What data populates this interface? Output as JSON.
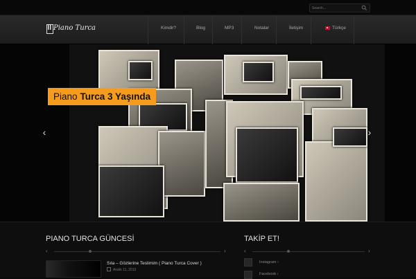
{
  "search": {
    "placeholder": "Search..."
  },
  "logo": {
    "text": "Piano Turca"
  },
  "nav": {
    "items": [
      "Kimdir?",
      "Blog",
      "MP3",
      "Notalar",
      "İletişim",
      "Türkçe"
    ]
  },
  "slider": {
    "caption_light": "Piano",
    "caption_bold": "Turca 3 Yaşında"
  },
  "blog": {
    "title": "PIANO TURCA GÜNCESİ",
    "post_title": "Sıla – Gözlerine Teslimim ( Piano Turca Cover )",
    "post_date": "Aralık 11, 2013"
  },
  "follow": {
    "title": "TAKİP ET!",
    "links": [
      "Instagram ›",
      "Facebook ›"
    ]
  },
  "colors": {
    "accent": "#f59c1f",
    "background": "#0b0b0b",
    "nav": "#252525"
  }
}
